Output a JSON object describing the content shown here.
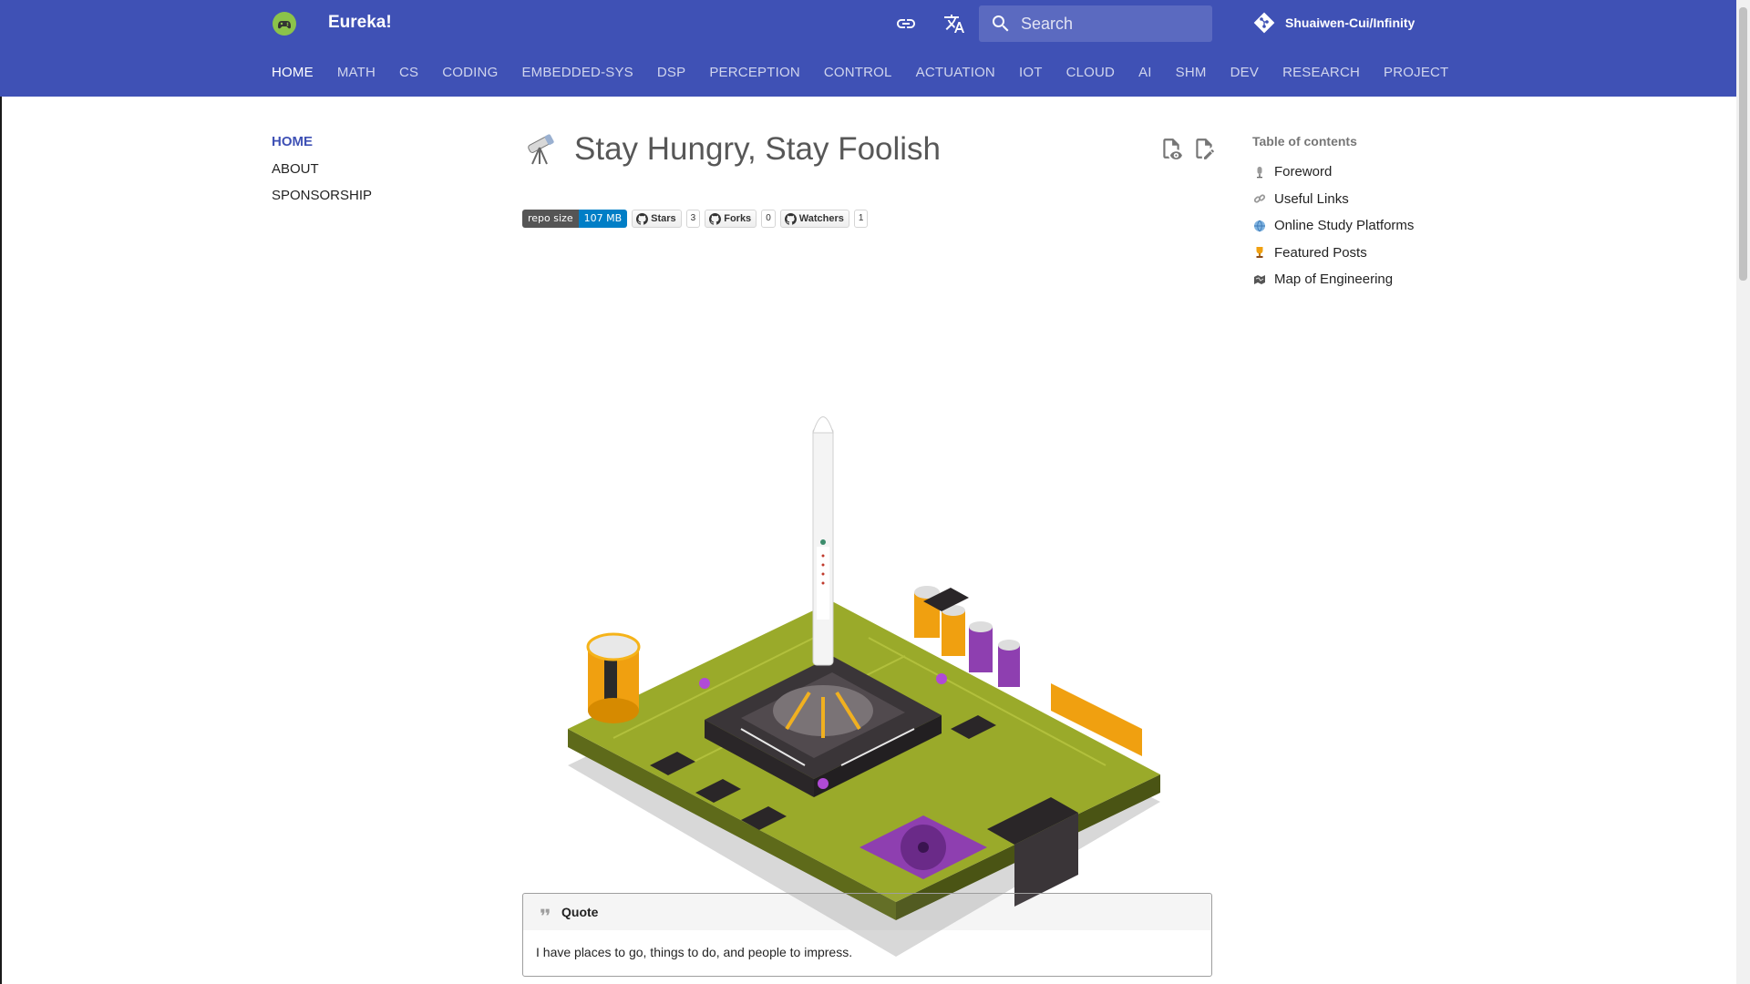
{
  "header": {
    "site_title": "Eureka!",
    "search_placeholder": "Search",
    "repo_name": "Shuaiwen-Cui/Infinity"
  },
  "tabs": [
    {
      "label": "HOME",
      "active": true
    },
    {
      "label": "MATH"
    },
    {
      "label": "CS"
    },
    {
      "label": "CODING"
    },
    {
      "label": "EMBEDDED-SYS"
    },
    {
      "label": "DSP"
    },
    {
      "label": "PERCEPTION"
    },
    {
      "label": "CONTROL"
    },
    {
      "label": "ACTUATION"
    },
    {
      "label": "IOT"
    },
    {
      "label": "CLOUD"
    },
    {
      "label": "AI"
    },
    {
      "label": "SHM"
    },
    {
      "label": "DEV"
    },
    {
      "label": "RESEARCH"
    },
    {
      "label": "PROJECT"
    }
  ],
  "leftnav": [
    {
      "label": "HOME",
      "active": true
    },
    {
      "label": "ABOUT"
    },
    {
      "label": "SPONSORSHIP"
    }
  ],
  "main": {
    "title": "Stay Hungry, Stay Foolish",
    "badges": {
      "repo_size_label": "repo size",
      "repo_size_value": "107 MB",
      "stars_label": "Stars",
      "stars_count": "3",
      "forks_label": "Forks",
      "forks_count": "0",
      "watchers_label": "Watchers",
      "watchers_count": "1"
    },
    "quote": {
      "title": "Quote",
      "text": "I have places to go, things to do, and people to impress."
    }
  },
  "toc": {
    "title": "Table of contents",
    "items": [
      {
        "label": "Foreword",
        "icon": "microphone-icon"
      },
      {
        "label": "Useful Links",
        "icon": "link-icon"
      },
      {
        "label": "Online Study Platforms",
        "icon": "globe-icon"
      },
      {
        "label": "Featured Posts",
        "icon": "trophy-icon"
      },
      {
        "label": "Map of Engineering",
        "icon": "map-icon"
      }
    ]
  },
  "colors": {
    "primary": "#3f51b5",
    "badge_blue": "#007ec6",
    "badge_gray": "#555555"
  }
}
